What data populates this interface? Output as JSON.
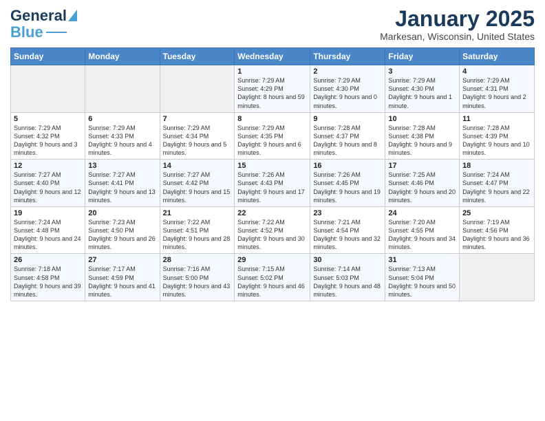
{
  "header": {
    "logo_general": "General",
    "logo_blue": "Blue",
    "month": "January 2025",
    "location": "Markesan, Wisconsin, United States"
  },
  "days_of_week": [
    "Sunday",
    "Monday",
    "Tuesday",
    "Wednesday",
    "Thursday",
    "Friday",
    "Saturday"
  ],
  "weeks": [
    [
      {
        "day": "",
        "info": ""
      },
      {
        "day": "",
        "info": ""
      },
      {
        "day": "",
        "info": ""
      },
      {
        "day": "1",
        "info": "Sunrise: 7:29 AM\nSunset: 4:29 PM\nDaylight: 8 hours and 59 minutes."
      },
      {
        "day": "2",
        "info": "Sunrise: 7:29 AM\nSunset: 4:30 PM\nDaylight: 9 hours and 0 minutes."
      },
      {
        "day": "3",
        "info": "Sunrise: 7:29 AM\nSunset: 4:30 PM\nDaylight: 9 hours and 1 minute."
      },
      {
        "day": "4",
        "info": "Sunrise: 7:29 AM\nSunset: 4:31 PM\nDaylight: 9 hours and 2 minutes."
      }
    ],
    [
      {
        "day": "5",
        "info": "Sunrise: 7:29 AM\nSunset: 4:32 PM\nDaylight: 9 hours and 3 minutes."
      },
      {
        "day": "6",
        "info": "Sunrise: 7:29 AM\nSunset: 4:33 PM\nDaylight: 9 hours and 4 minutes."
      },
      {
        "day": "7",
        "info": "Sunrise: 7:29 AM\nSunset: 4:34 PM\nDaylight: 9 hours and 5 minutes."
      },
      {
        "day": "8",
        "info": "Sunrise: 7:29 AM\nSunset: 4:35 PM\nDaylight: 9 hours and 6 minutes."
      },
      {
        "day": "9",
        "info": "Sunrise: 7:28 AM\nSunset: 4:37 PM\nDaylight: 9 hours and 8 minutes."
      },
      {
        "day": "10",
        "info": "Sunrise: 7:28 AM\nSunset: 4:38 PM\nDaylight: 9 hours and 9 minutes."
      },
      {
        "day": "11",
        "info": "Sunrise: 7:28 AM\nSunset: 4:39 PM\nDaylight: 9 hours and 10 minutes."
      }
    ],
    [
      {
        "day": "12",
        "info": "Sunrise: 7:27 AM\nSunset: 4:40 PM\nDaylight: 9 hours and 12 minutes."
      },
      {
        "day": "13",
        "info": "Sunrise: 7:27 AM\nSunset: 4:41 PM\nDaylight: 9 hours and 13 minutes."
      },
      {
        "day": "14",
        "info": "Sunrise: 7:27 AM\nSunset: 4:42 PM\nDaylight: 9 hours and 15 minutes."
      },
      {
        "day": "15",
        "info": "Sunrise: 7:26 AM\nSunset: 4:43 PM\nDaylight: 9 hours and 17 minutes."
      },
      {
        "day": "16",
        "info": "Sunrise: 7:26 AM\nSunset: 4:45 PM\nDaylight: 9 hours and 19 minutes."
      },
      {
        "day": "17",
        "info": "Sunrise: 7:25 AM\nSunset: 4:46 PM\nDaylight: 9 hours and 20 minutes."
      },
      {
        "day": "18",
        "info": "Sunrise: 7:24 AM\nSunset: 4:47 PM\nDaylight: 9 hours and 22 minutes."
      }
    ],
    [
      {
        "day": "19",
        "info": "Sunrise: 7:24 AM\nSunset: 4:48 PM\nDaylight: 9 hours and 24 minutes."
      },
      {
        "day": "20",
        "info": "Sunrise: 7:23 AM\nSunset: 4:50 PM\nDaylight: 9 hours and 26 minutes."
      },
      {
        "day": "21",
        "info": "Sunrise: 7:22 AM\nSunset: 4:51 PM\nDaylight: 9 hours and 28 minutes."
      },
      {
        "day": "22",
        "info": "Sunrise: 7:22 AM\nSunset: 4:52 PM\nDaylight: 9 hours and 30 minutes."
      },
      {
        "day": "23",
        "info": "Sunrise: 7:21 AM\nSunset: 4:54 PM\nDaylight: 9 hours and 32 minutes."
      },
      {
        "day": "24",
        "info": "Sunrise: 7:20 AM\nSunset: 4:55 PM\nDaylight: 9 hours and 34 minutes."
      },
      {
        "day": "25",
        "info": "Sunrise: 7:19 AM\nSunset: 4:56 PM\nDaylight: 9 hours and 36 minutes."
      }
    ],
    [
      {
        "day": "26",
        "info": "Sunrise: 7:18 AM\nSunset: 4:58 PM\nDaylight: 9 hours and 39 minutes."
      },
      {
        "day": "27",
        "info": "Sunrise: 7:17 AM\nSunset: 4:59 PM\nDaylight: 9 hours and 41 minutes."
      },
      {
        "day": "28",
        "info": "Sunrise: 7:16 AM\nSunset: 5:00 PM\nDaylight: 9 hours and 43 minutes."
      },
      {
        "day": "29",
        "info": "Sunrise: 7:15 AM\nSunset: 5:02 PM\nDaylight: 9 hours and 46 minutes."
      },
      {
        "day": "30",
        "info": "Sunrise: 7:14 AM\nSunset: 5:03 PM\nDaylight: 9 hours and 48 minutes."
      },
      {
        "day": "31",
        "info": "Sunrise: 7:13 AM\nSunset: 5:04 PM\nDaylight: 9 hours and 50 minutes."
      },
      {
        "day": "",
        "info": ""
      }
    ]
  ]
}
